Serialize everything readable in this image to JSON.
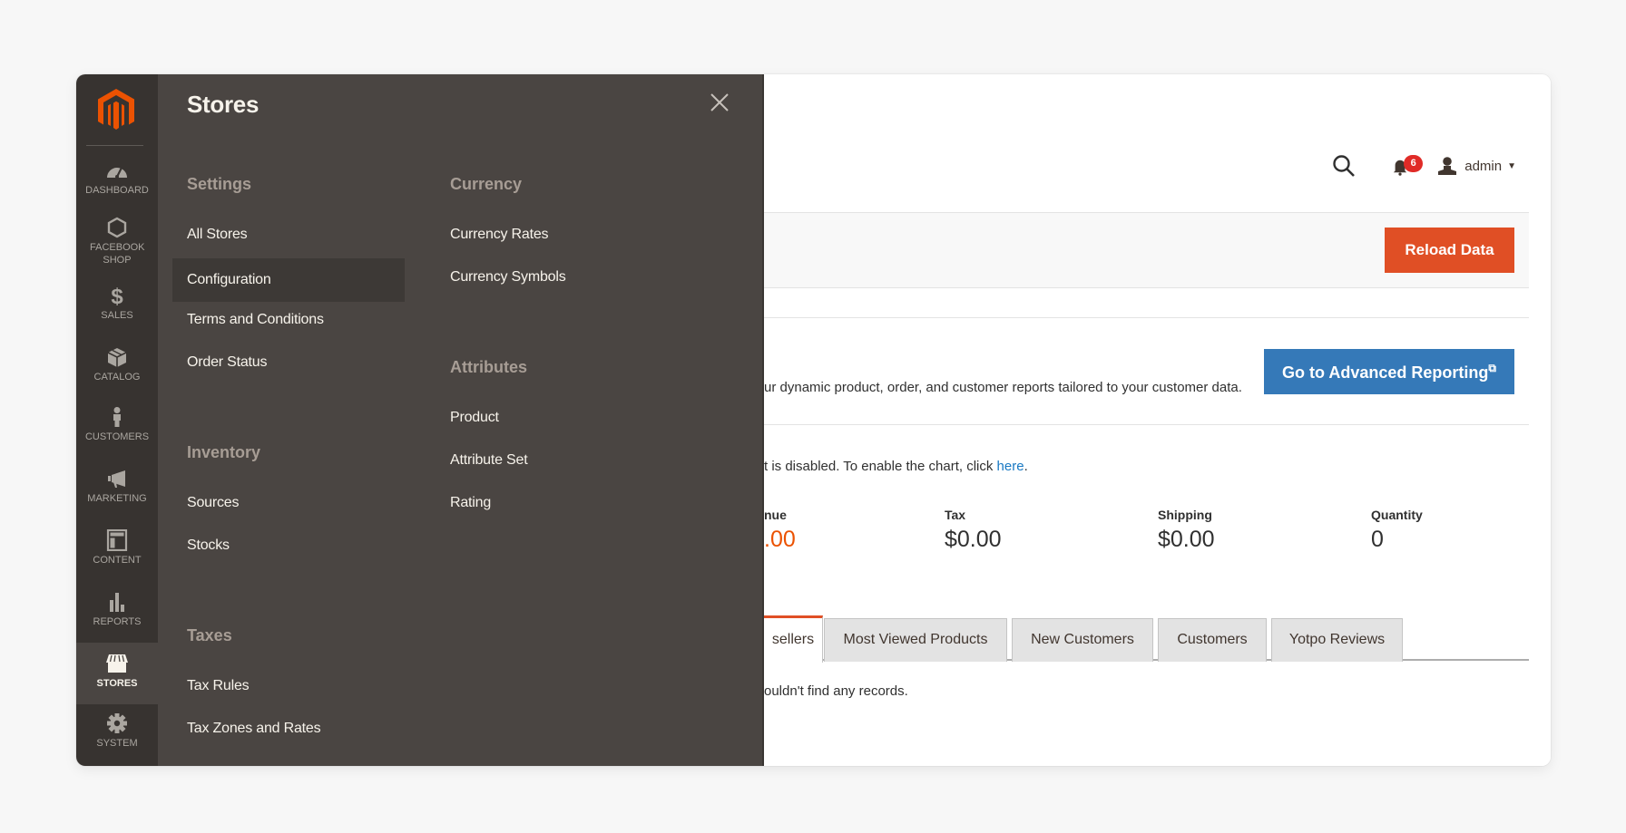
{
  "nav": {
    "items": [
      {
        "label": "DASHBOARD",
        "icon": "dashboard-icon"
      },
      {
        "label": "FACEBOOK SHOP",
        "icon": "hexagon-icon"
      },
      {
        "label": "SALES",
        "icon": "dollar-icon"
      },
      {
        "label": "CATALOG",
        "icon": "box-icon"
      },
      {
        "label": "CUSTOMERS",
        "icon": "person-icon"
      },
      {
        "label": "MARKETING",
        "icon": "megaphone-icon"
      },
      {
        "label": "CONTENT",
        "icon": "layout-icon"
      },
      {
        "label": "REPORTS",
        "icon": "bar-chart-icon"
      },
      {
        "label": "STORES",
        "icon": "storefront-icon",
        "active": true
      },
      {
        "label": "SYSTEM",
        "icon": "gear-icon"
      }
    ]
  },
  "flyout": {
    "title": "Stores",
    "groups": {
      "settings": {
        "title": "Settings",
        "links": [
          "All Stores",
          "Configuration",
          "Terms and Conditions",
          "Order Status"
        ]
      },
      "inventory": {
        "title": "Inventory",
        "links": [
          "Sources",
          "Stocks"
        ]
      },
      "taxes": {
        "title": "Taxes",
        "links": [
          "Tax Rules",
          "Tax Zones and Rates"
        ]
      },
      "currency": {
        "title": "Currency",
        "links": [
          "Currency Rates",
          "Currency Symbols"
        ]
      },
      "attributes": {
        "title": "Attributes",
        "links": [
          "Product",
          "Attribute Set",
          "Rating"
        ]
      }
    },
    "highlighted": "Configuration"
  },
  "header": {
    "notifications_count": "6",
    "user_name": "admin"
  },
  "toolbar": {
    "reload_label": "Reload Data"
  },
  "advanced_reporting": {
    "description": "ur dynamic product, order, and customer reports tailored to your customer data.",
    "button_label": "Go to Advanced Reporting"
  },
  "chart_note": {
    "text": "t is disabled. To enable the chart, click ",
    "link": "here",
    "suffix": "."
  },
  "stats": [
    {
      "label": "nue",
      "value": ".00",
      "accent": true
    },
    {
      "label": "Tax",
      "value": "$0.00"
    },
    {
      "label": "Shipping",
      "value": "$0.00"
    },
    {
      "label": "Quantity",
      "value": "0"
    }
  ],
  "tabs": [
    {
      "label": "sellers",
      "active": true
    },
    {
      "label": "Most Viewed Products"
    },
    {
      "label": "New Customers"
    },
    {
      "label": "Customers"
    },
    {
      "label": "Yotpo Reviews"
    }
  ],
  "empty_message": "ouldn't find any records.",
  "colors": {
    "brand_orange": "#e04f25",
    "accent_blue": "#3579b8",
    "nav_bg": "#373330",
    "flyout_bg": "#4a4542",
    "badge_red": "#e02b27"
  }
}
